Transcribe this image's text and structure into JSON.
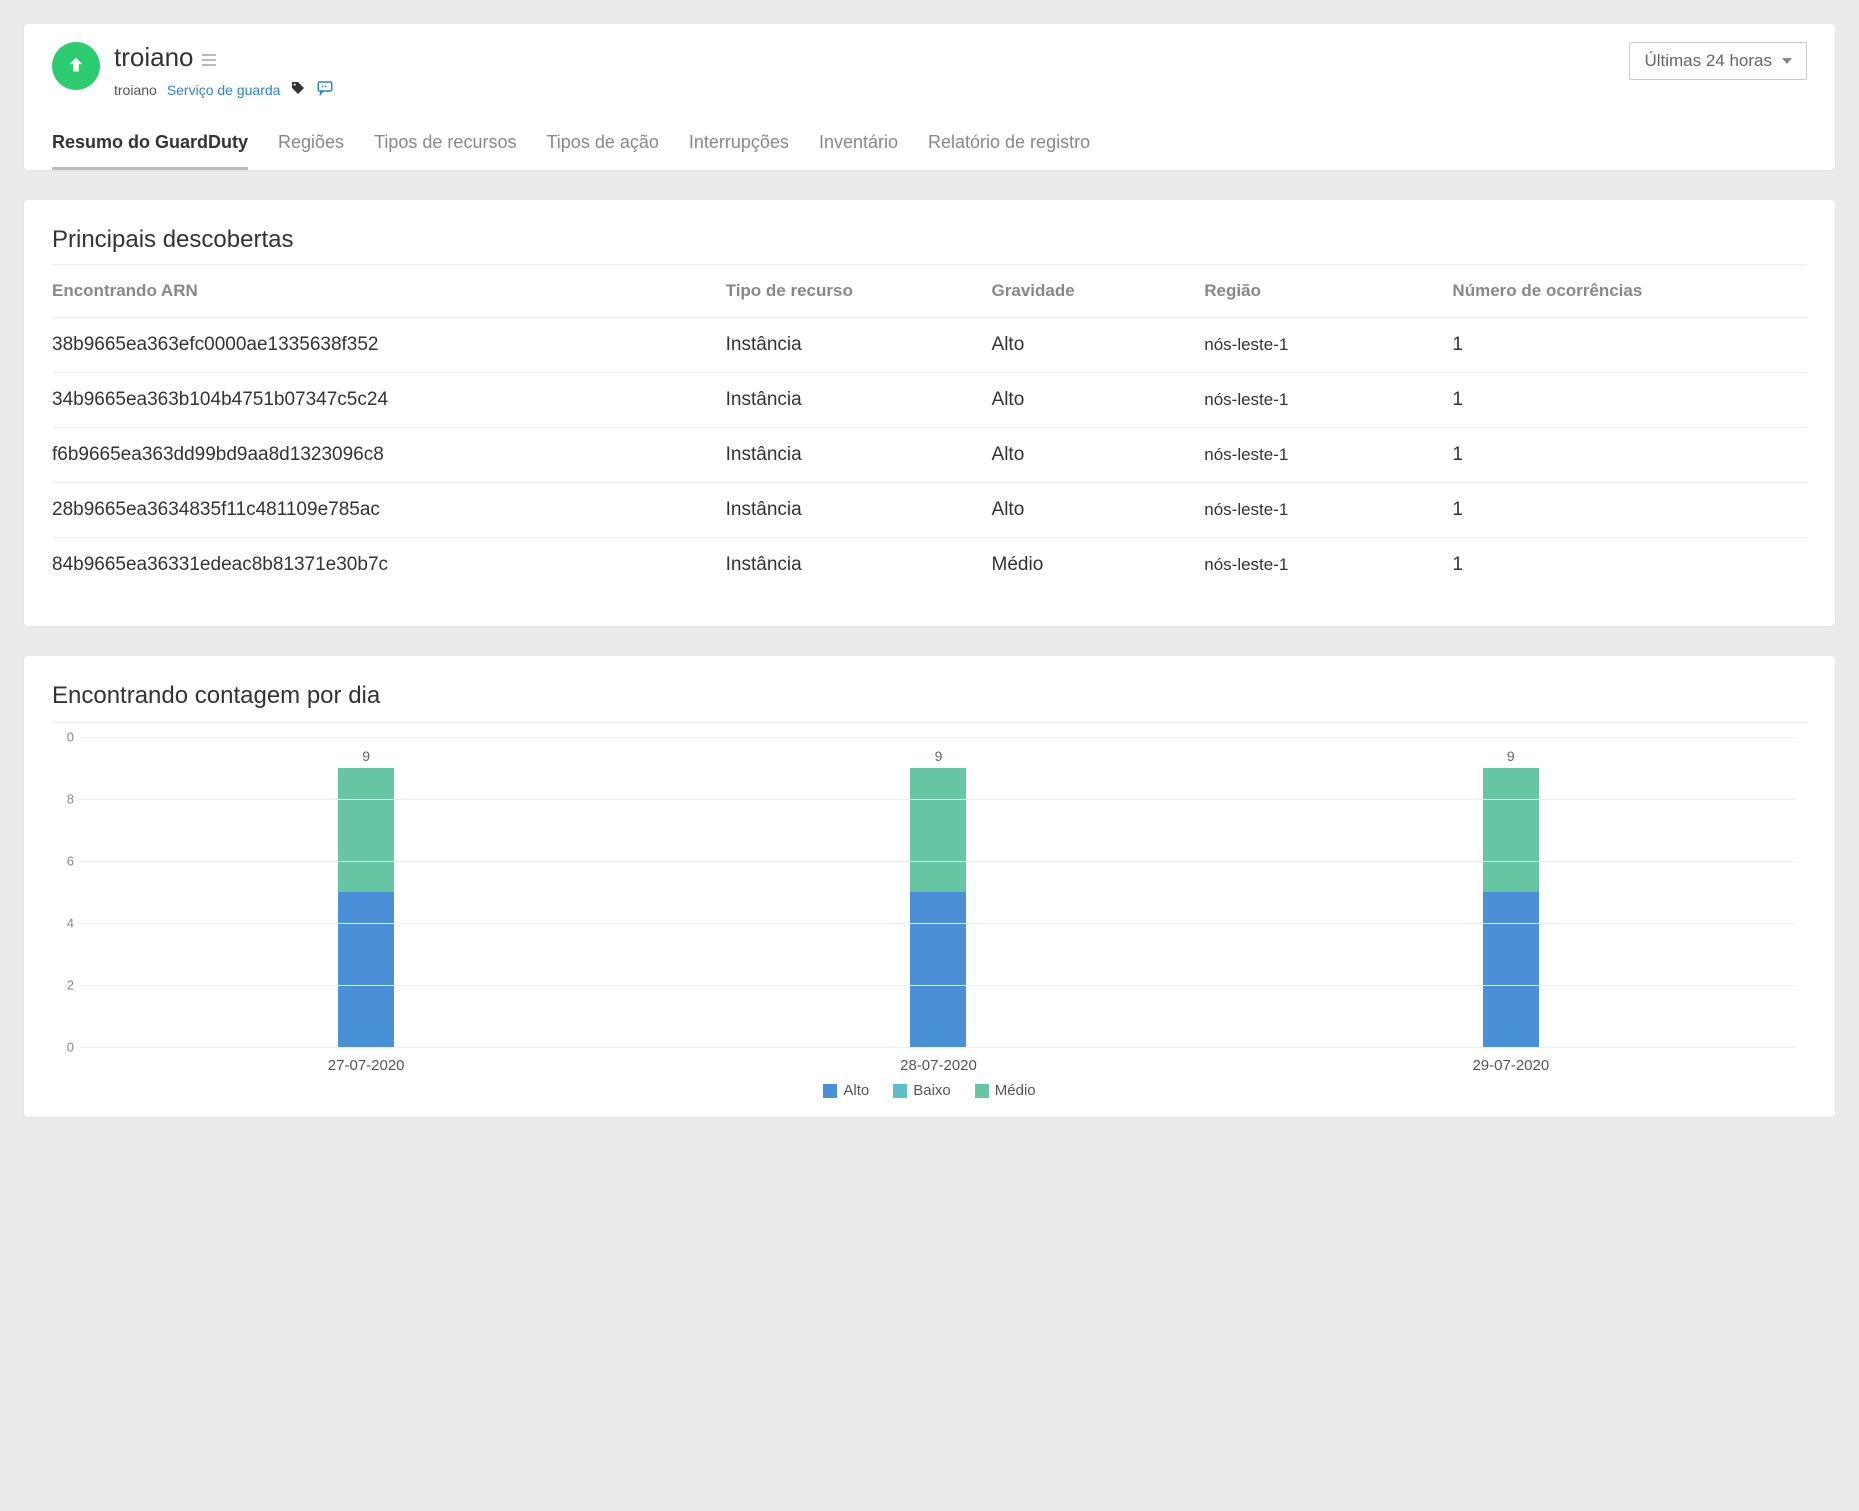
{
  "header": {
    "title": "troiano",
    "breadcrumb_plain": "troiano",
    "breadcrumb_link": "Serviço de guarda",
    "time_range": "Últimas 24 horas"
  },
  "tabs": [
    {
      "label": "Resumo do GuardDuty",
      "active": true
    },
    {
      "label": "Regiões",
      "active": false
    },
    {
      "label": "Tipos de recursos",
      "active": false
    },
    {
      "label": "Tipos de ação",
      "active": false
    },
    {
      "label": "Interrupções",
      "active": false
    },
    {
      "label": "Inventário",
      "active": false
    },
    {
      "label": "Relatório de registro",
      "active": false
    }
  ],
  "findings": {
    "title": "Principais descobertas",
    "columns": {
      "arn": "Encontrando ARN",
      "type": "Tipo de recurso",
      "severity": "Gravidade",
      "region": "Região",
      "occurrences": "Número de ocorrências"
    },
    "rows": [
      {
        "arn": "38b9665ea363efc0000ae1335638f352",
        "type": "Instância",
        "severity": "Alto",
        "region": "nós-leste-1",
        "occurrences": "1"
      },
      {
        "arn": "34b9665ea363b104b4751b07347c5c24",
        "type": "Instância",
        "severity": "Alto",
        "region": "nós-leste-1",
        "occurrences": "1"
      },
      {
        "arn": "f6b9665ea363dd99bd9aa8d1323096c8",
        "type": "Instância",
        "severity": "Alto",
        "region": "nós-leste-1",
        "occurrences": "1"
      },
      {
        "arn": "28b9665ea3634835f11c481109e785ac",
        "type": "Instância",
        "severity": "Alto",
        "region": "nós-leste-1",
        "occurrences": "1"
      },
      {
        "arn": "84b9665ea36331edeac8b81371e30b7c",
        "type": "Instância",
        "severity": "Médio",
        "region": "nós-leste-1",
        "occurrences": "1"
      }
    ]
  },
  "chart": {
    "title": "Encontrando contagem por dia",
    "legend": {
      "alto": "Alto",
      "baixo": "Baixo",
      "medio": "Médio"
    },
    "yticks": [
      "0",
      "2",
      "4",
      "6",
      "8",
      "0"
    ]
  },
  "chart_data": {
    "type": "bar",
    "stacked": true,
    "title": "Encontrando contagem por dia",
    "categories": [
      "27-07-2020",
      "28-07-2020",
      "29-07-2020"
    ],
    "series": [
      {
        "name": "Alto",
        "values": [
          5,
          5,
          5
        ],
        "color": "#4a90d9"
      },
      {
        "name": "Baixo",
        "values": [
          0,
          0,
          0
        ],
        "color": "#5fbfc8"
      },
      {
        "name": "Médio",
        "values": [
          4,
          4,
          4
        ],
        "color": "#66c6a3"
      }
    ],
    "totals": [
      9,
      9,
      9
    ],
    "ylim": [
      0,
      10
    ],
    "yticks": [
      0,
      2,
      4,
      6,
      8,
      0
    ],
    "xlabel": "",
    "ylabel": ""
  }
}
